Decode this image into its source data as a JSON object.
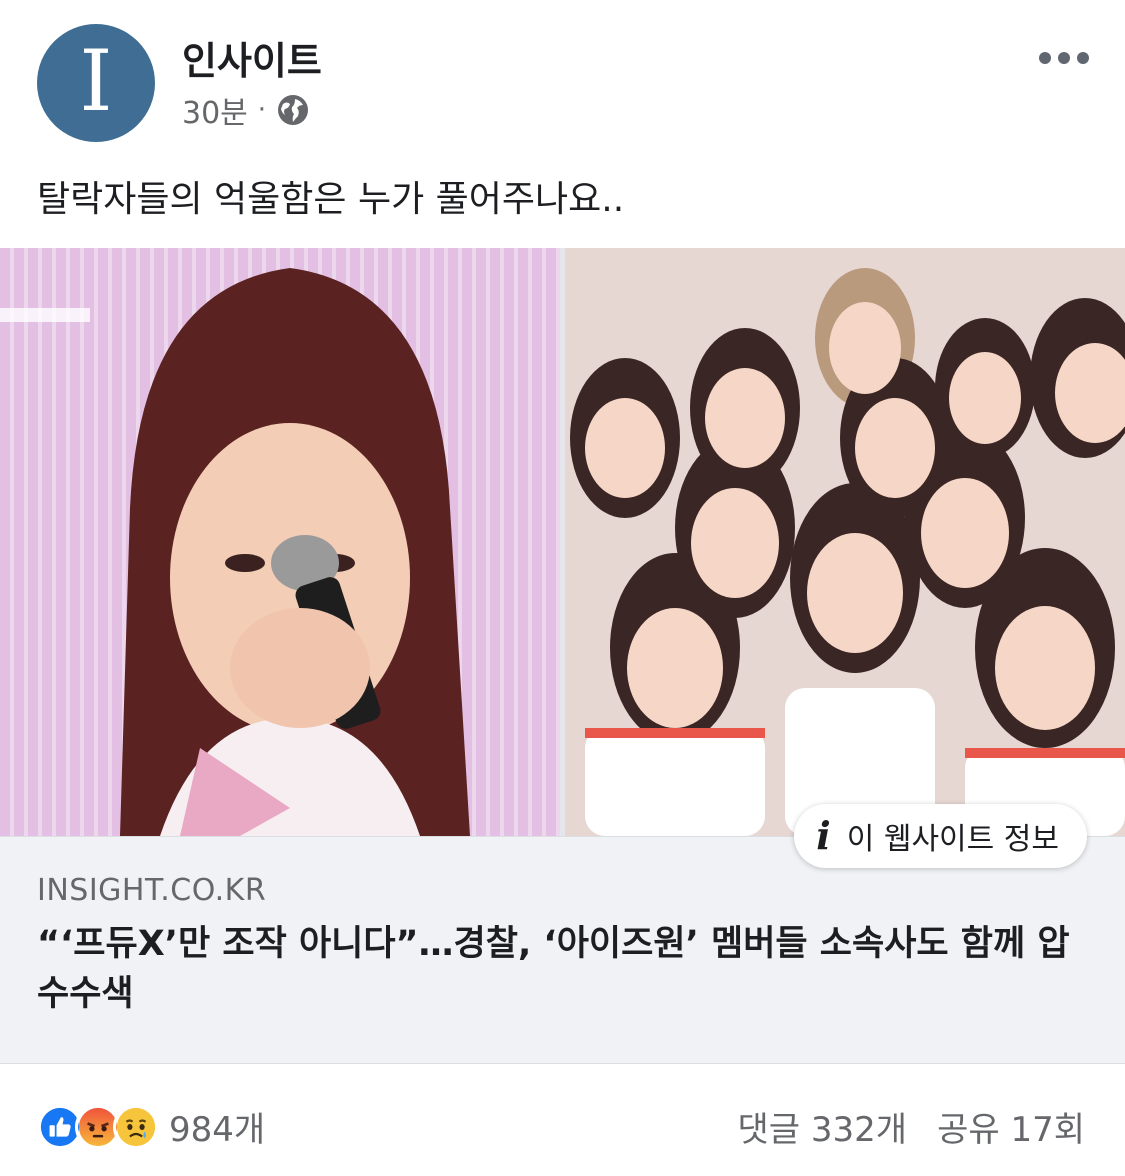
{
  "post": {
    "page_name": "인사이트",
    "avatar_letter": "I",
    "timestamp": "30분",
    "separator": "·",
    "caption": "탈락자들의 억울함은 누가 풀어주나요.."
  },
  "link_preview": {
    "info_label": "이 웹사이트 정보",
    "domain": "INSIGHT.CO.KR",
    "headline": "“‘프듀X’만 조작 아니다”…경찰, ‘아이즈원’ 멤버들 소속사도 함께 압수수색"
  },
  "engagement": {
    "reaction_count": "984개",
    "comments": "댓글 332개",
    "shares": "공유 17회"
  },
  "colors": {
    "avatar_bg": "#3f6d93",
    "like_blue": "#1877f2",
    "angry_orange": "#f0543c",
    "sad_yellow": "#f7c53b",
    "card_bg": "#f0f2f5",
    "secondary_text": "#65676b"
  },
  "icons": [
    "globe-icon",
    "more-icon",
    "info-icon",
    "like-reaction-icon",
    "angry-reaction-icon",
    "sad-reaction-icon"
  ]
}
